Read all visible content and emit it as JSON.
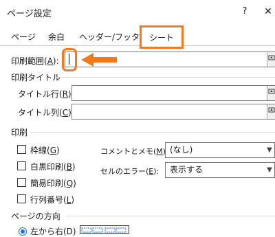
{
  "window": {
    "title": "ページ設定",
    "help_label": "?",
    "close_label": "✕"
  },
  "tabs": [
    {
      "label": "ページ"
    },
    {
      "label": "余白"
    },
    {
      "label": "ヘッダー/フッター"
    },
    {
      "label": "シート",
      "active": true
    }
  ],
  "print_area": {
    "label_prefix": "印刷範囲(",
    "label_key": "A",
    "label_suffix": "):",
    "value": ""
  },
  "print_titles": {
    "section_label": "印刷タイトル",
    "rows_label_prefix": "タイトル行(",
    "rows_label_key": "R",
    "rows_label_suffix": "):",
    "cols_label_prefix": "タイトル列(",
    "cols_label_key": "C",
    "cols_label_suffix": "):"
  },
  "print": {
    "section_label": "印刷",
    "checkboxes": [
      {
        "prefix": "枠線(",
        "key": "G",
        "suffix": ")",
        "checked": false
      },
      {
        "prefix": "白黒印刷(",
        "key": "B",
        "suffix": ")",
        "checked": false
      },
      {
        "prefix": "簡易印刷(",
        "key": "Q",
        "suffix": ")",
        "checked": false
      },
      {
        "prefix": "行列番号(",
        "key": "L",
        "suffix": ")",
        "checked": false
      }
    ],
    "comments": {
      "label_prefix": "コメントとメモ(",
      "label_key": "M",
      "label_suffix": "):",
      "value": "(なし)"
    },
    "cell_errors": {
      "label_prefix": "セルのエラー(",
      "label_key": "E",
      "label_suffix": "):",
      "value": "表示する"
    }
  },
  "page_order": {
    "section_label": "ページの方向",
    "option_label": "左から右(D)"
  },
  "colors": {
    "highlight": "#f27a1c",
    "accent": "#1a73e8"
  },
  "icons": {
    "collapse": "collapse-dialog-icon",
    "arrow": "pointer-arrow-icon"
  }
}
